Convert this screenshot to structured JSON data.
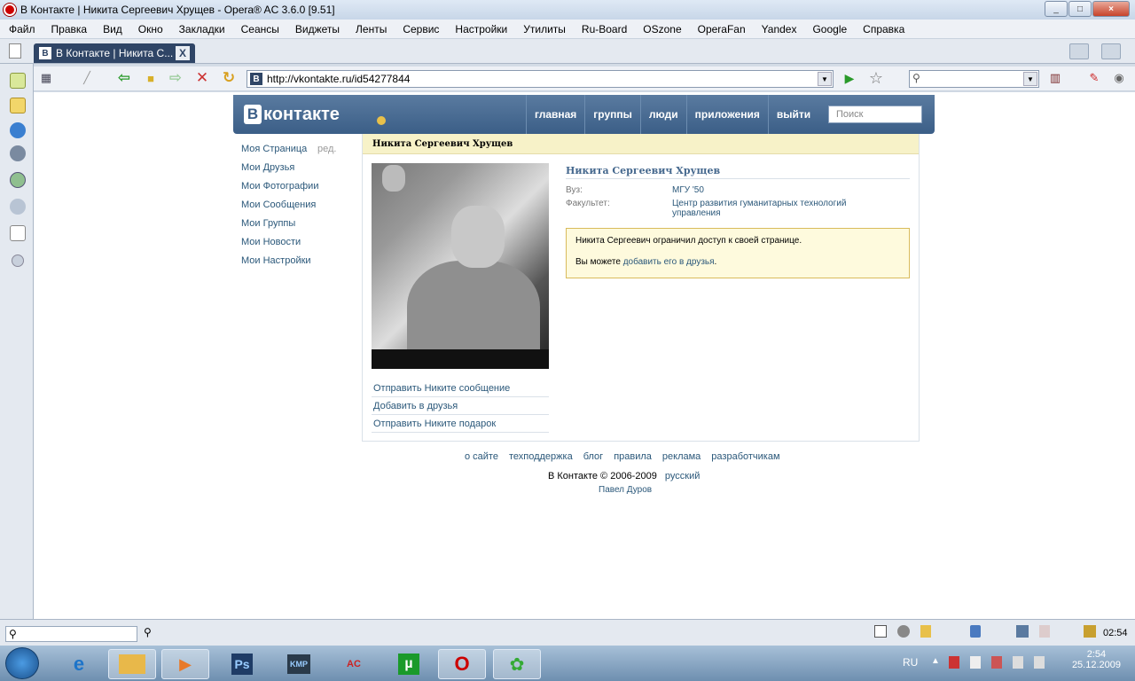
{
  "window": {
    "title": "В Контакте | Никита Сергеевич Хрущев - Opera® AC 3.6.0 [9.51]"
  },
  "menu": [
    "Файл",
    "Правка",
    "Вид",
    "Окно",
    "Закладки",
    "Сеансы",
    "Виджеты",
    "Ленты",
    "Сервис",
    "Настройки",
    "Утилиты",
    "Ru-Board",
    "OSzone",
    "OperaFan",
    "Yandex",
    "Google",
    "Справка"
  ],
  "tab": {
    "favicon": "В",
    "label": "В Контакте | Никита С...",
    "close": "X"
  },
  "address": {
    "favicon": "В",
    "url": "http://vkontakte.ru/id54277844"
  },
  "vk": {
    "logo_letter": "В",
    "logo_text": "контакте",
    "nav": [
      "главная",
      "группы",
      "люди",
      "приложения",
      "выйти"
    ],
    "search_placeholder": "Поиск",
    "left_menu": [
      "Моя Страница",
      "Мои Друзья",
      "Мои Фотографии",
      "Мои Сообщения",
      "Мои Группы",
      "Мои Новости",
      "Мои Настройки"
    ],
    "edit_link": "ред.",
    "profile": {
      "header": "Никита Сергеевич Хрущев",
      "name": "Никита Сергеевич Хрущев",
      "fields": [
        {
          "label": "Вуз:",
          "value": "МГУ '50"
        },
        {
          "label": "Факультет:",
          "value": "Центр развития гуманитарных технологий управления"
        }
      ],
      "notice_line1": "Никита Сергеевич ограничил доступ к своей странице.",
      "notice_prefix": "Вы можете ",
      "notice_link": "добавить его в друзья",
      "notice_suffix": ".",
      "actions": [
        "Отправить Никите сообщение",
        "Добавить в друзья",
        "Отправить Никите подарок"
      ]
    },
    "footer_links": [
      "о сайте",
      "техподдержка",
      "блог",
      "правила",
      "реклама",
      "разработчикам"
    ],
    "copyright": "В Контакте © 2006-2009",
    "language": "русский",
    "author": "Павел Дуров"
  },
  "statusbar": {
    "time": "02:54"
  },
  "taskbar": {
    "language": "RU",
    "clock_time": "2:54",
    "clock_date": "25.12.2009",
    "apps": [
      {
        "name": "ie",
        "label": "e",
        "color": "#1d74c9"
      },
      {
        "name": "explorer",
        "label": "",
        "color": "#e8b84a"
      },
      {
        "name": "media-player",
        "label": "▶",
        "color": "#e87a2a"
      },
      {
        "name": "photoshop",
        "label": "Ps",
        "color": "#1f3c66"
      },
      {
        "name": "kmplayer",
        "label": "KMP",
        "color": "#2a3a4a"
      },
      {
        "name": "opera-ac",
        "label": "AC",
        "color": "#c22"
      },
      {
        "name": "utorrent",
        "label": "µ",
        "color": "#1a9a2a"
      },
      {
        "name": "opera",
        "label": "O",
        "color": "#c00"
      },
      {
        "name": "tree-app",
        "label": "✿",
        "color": "#3a3"
      }
    ]
  }
}
